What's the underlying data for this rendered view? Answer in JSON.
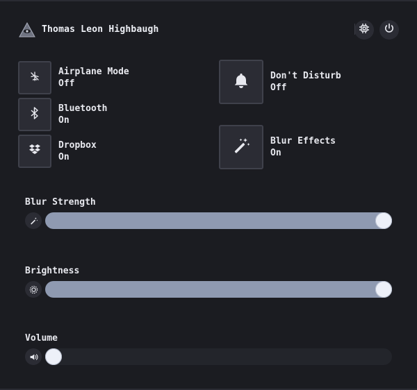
{
  "header": {
    "username": "Thomas Leon Highbaugh",
    "logo_icon": "eye-pyramid-icon",
    "cpu_icon": "cpu-chip-icon",
    "power_icon": "power-icon"
  },
  "toggles": [
    {
      "id": "airplane",
      "label": "Airplane Mode",
      "state": "Off",
      "icon": "airplane-icon"
    },
    {
      "id": "bluetooth",
      "label": "Bluetooth",
      "state": "On",
      "icon": "bluetooth-icon"
    },
    {
      "id": "dropbox",
      "label": "Dropbox",
      "state": "On",
      "icon": "dropbox-icon"
    },
    {
      "id": "dnd",
      "label": "Don't Disturb",
      "state": "Off",
      "icon": "bell-icon"
    },
    {
      "id": "blur",
      "label": "Blur Effects",
      "state": "On",
      "icon": "magic-wand-icon"
    }
  ],
  "sliders": [
    {
      "id": "blur-strength",
      "label": "Blur Strength",
      "value": 1.0,
      "icon": "magic-wand-icon"
    },
    {
      "id": "brightness",
      "label": "Brightness",
      "value": 1.0,
      "icon": "brightness-icon"
    },
    {
      "id": "volume",
      "label": "Volume",
      "value": 0.0,
      "icon": "volume-icon"
    }
  ],
  "colors": {
    "background": "#1b1c21",
    "button": "#2b2c34",
    "slider_fill": "#8f9ab1",
    "slider_track": "#23252b",
    "knob": "#edf0f8"
  }
}
